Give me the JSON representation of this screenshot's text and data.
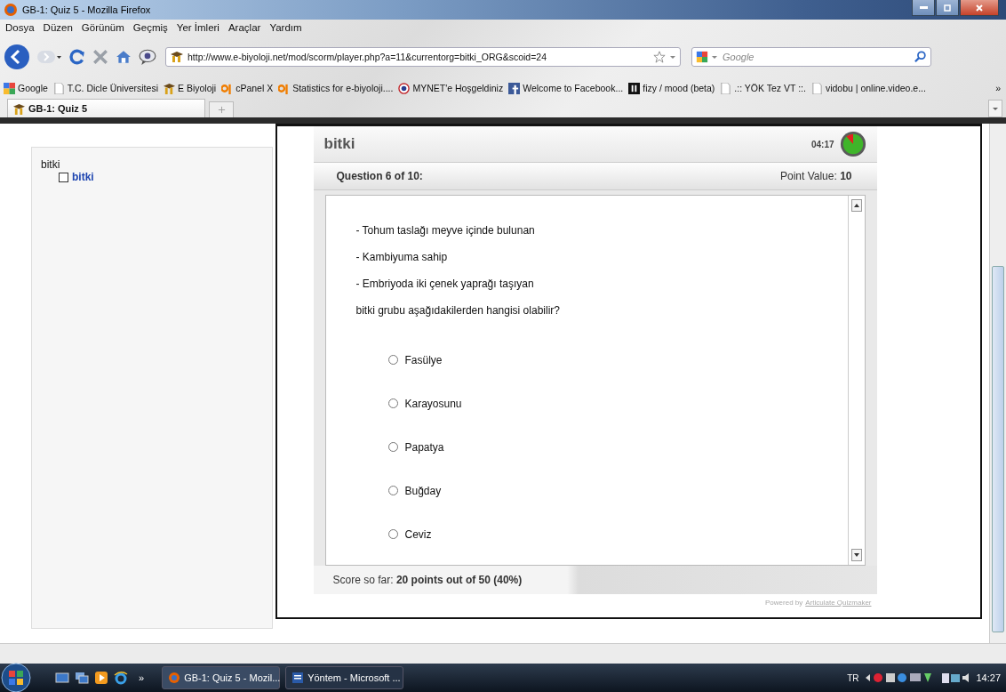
{
  "window": {
    "title": "GB-1: Quiz 5 - Mozilla Firefox"
  },
  "menu": [
    "Dosya",
    "Düzen",
    "Görünüm",
    "Geçmiş",
    "Yer İmleri",
    "Araçlar",
    "Yardım"
  ],
  "address": {
    "url": "http://www.e-biyoloji.net/mod/scorm/player.php?a=11&currentorg=bitki_ORG&scoid=24"
  },
  "search": {
    "placeholder": "Google"
  },
  "bookmarks": [
    {
      "label": "Google",
      "kind": "google"
    },
    {
      "label": "T.C. Dicle Üniversitesi",
      "kind": "page"
    },
    {
      "label": "E Biyoloji",
      "kind": "moodle"
    },
    {
      "label": "cPanel X",
      "kind": "cpanel"
    },
    {
      "label": "Statistics for e-biyoloji....",
      "kind": "cpanel"
    },
    {
      "label": "MYNET'e Hoşgeldiniz",
      "kind": "mynet"
    },
    {
      "label": "Welcome to Facebook...",
      "kind": "facebook"
    },
    {
      "label": "fizy / mood (beta)",
      "kind": "fizy"
    },
    {
      "label": ".:: YÖK Tez VT ::.",
      "kind": "page"
    },
    {
      "label": "vidobu | online.video.e...",
      "kind": "page"
    }
  ],
  "bookmarks_more": "»",
  "tabs": [
    {
      "label": "GB-1: Quiz 5",
      "selected": true
    }
  ],
  "toc": {
    "heading": "bitki",
    "items": [
      {
        "label": "bitki",
        "checked": false
      }
    ]
  },
  "quiz": {
    "title": "bitki",
    "timer": "04:17",
    "question_header": "Question 6 of 10:",
    "point_value": "Point Value: **10**",
    "lines": [
      "- Tohum taslağı meyve içinde bulunan",
      "- Kambiyuma sahip",
      "- Embriyoda iki çenek yaprağı taşıyan",
      "bitki grubu aşağıdakilerden hangisi olabilir?"
    ],
    "options": [
      {
        "label": "Fasülye",
        "selected": false
      },
      {
        "label": "Karayosunu",
        "selected": false
      },
      {
        "label": "Papatya",
        "selected": false
      },
      {
        "label": "Buğday",
        "selected": false
      },
      {
        "label": "Ceviz",
        "selected": false
      }
    ],
    "score": "Score so far: **20 points out of 50 (40%)**",
    "powered_by": "Powered by",
    "powered_link": "Articulate Quizmaker"
  },
  "taskbar": {
    "more": "»",
    "items": [
      {
        "label": "GB-1: Quiz 5 - Mozil...",
        "kind": "firefox",
        "selected": true
      },
      {
        "label": "Yöntem - Microsoft ...",
        "kind": "word",
        "selected": false
      }
    ],
    "language": "TR",
    "clock": "14:27"
  }
}
